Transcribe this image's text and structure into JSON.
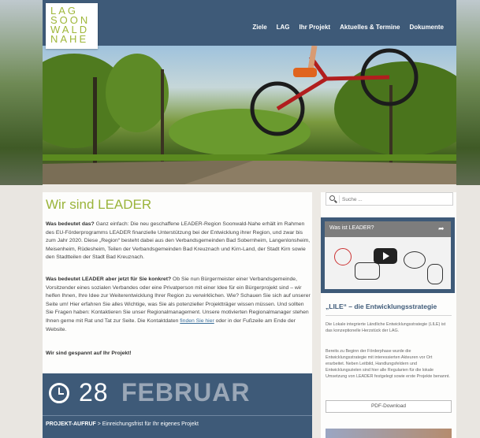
{
  "logo": {
    "lines": [
      "LAG",
      "SOON",
      "WALD",
      "NAHE"
    ]
  },
  "nav": {
    "items": [
      "Ziele",
      "LAG",
      "Ihr Projekt",
      "Aktuelles & Termine",
      "Dokumente"
    ]
  },
  "main": {
    "title": "Wir sind LEADER",
    "p1_bold": "Was bedeutet das?",
    "p1_text": " Ganz einfach: Die neu geschaffene LEADER-Region Soonwald-Nahe erhält im Rahmen des EU-Förderprogramms LEADER finanzielle Unterstützung bei der Entwicklung ihrer Region, und zwar bis zum Jahr 2020. Diese „Region“ besteht dabei aus den Verbandsgemeinden Bad Sobernheim, Langenlonsheim, Meisenheim, Rüdesheim, Teilen der Verbandsgemeinden Bad Kreuznach und Kirn-Land, der Stadt Kirn sowie den Stadtteilen der Stadt Bad Kreuznach.",
    "p2_bold": "Was bedeutet LEADER aber jetzt für Sie konkret?",
    "p2_text_a": " Ob Sie nun Bürgermeister einer Verbandsgemeinde, Vorsitzender eines sozialen Verbandes oder eine Privatperson mit einer Idee für ein Bürgerprojekt sind – wir helfen Ihnen, Ihre Idee zur Weiterentwicklung Ihrer Region zu verwirklichen. Wie? Schauen Sie sich auf unserer Seite um! Hier erfahren Sie alles Wichtige, was Sie als potenzieller Projektträger wissen müssen. Und sollten Sie Fragen haben: Kontaktieren Sie unser Regionalmanagement. Unsere motivierten Regionalmanager stehen Ihnen gerne mit Rat und Tat zur Seite. Die Kontaktdaten ",
    "p2_link": "finden Sie hier",
    "p2_text_b": " oder in der Fußzeile am Ende der Website.",
    "p3_bold": "Wir sind gespannt auf Ihr Projekt!"
  },
  "event": {
    "day": "28",
    "month": "FEBRUAR",
    "label_bold": "PROJEKT-AUFRUF",
    "label_text": " > Einreichungsfrist für Ihr eigenes Projekt"
  },
  "sidebar": {
    "search_placeholder": "Suche ...",
    "video_title": "Was ist LEADER?",
    "lile_title": "„LILE“ – die Entwicklungsstrategie",
    "lile_p1": "Die Lokale integrierte Ländliche Entwicklungsstrategie (LILE) ist das konzeptionelle Herzstück der LAG.",
    "lile_p2": "Bereits zu Beginn der Förderphase wurde die Entwicklungsstrategie mit interessierten Akteuren vor Ort erarbeitet. Neben Leitbild, Handlungsfeldern und Entwicklungszielen sind hier alle Regularien für die lokale Umsetzung von LEADER festgelegt sowie erste Projekte benannt.",
    "pdf_button": "PDF-Download"
  },
  "colors": {
    "primary": "#3e5a78",
    "accent": "#9ab43a"
  }
}
